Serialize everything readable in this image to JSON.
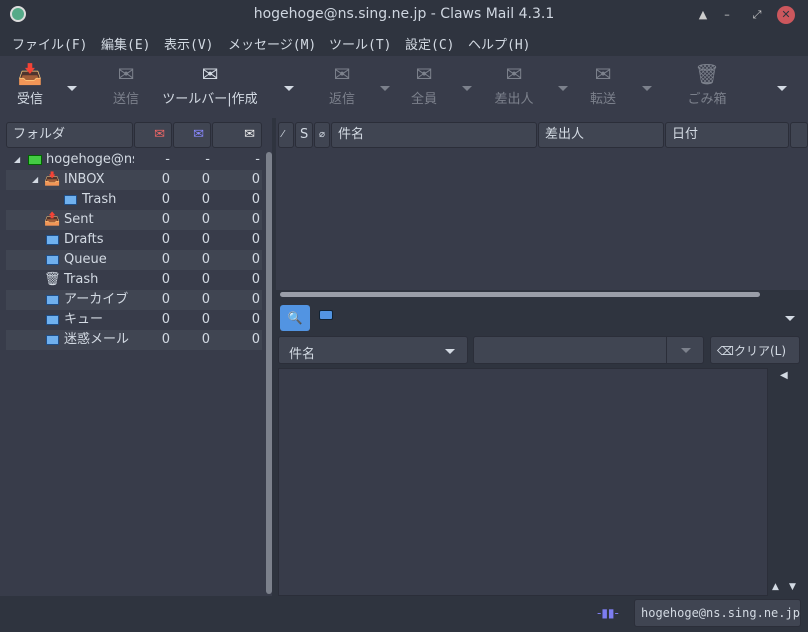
{
  "window": {
    "title": "hogehoge@ns.sing.ne.jp - Claws Mail 4.3.1"
  },
  "menu": [
    "ファイル(F)",
    "編集(E)",
    "表示(V)",
    "メッセージ(M)",
    "ツール(T)",
    "設定(C)",
    "ヘルプ(H)"
  ],
  "toolbar": {
    "receive": "受信",
    "send": "送信",
    "compose": "ツールバー|作成",
    "reply": "返信",
    "reply_all": "全員",
    "reply_sender": "差出人",
    "forward": "転送",
    "trash": "ごみ箱"
  },
  "folder_header": {
    "label": "フォルダ"
  },
  "folders": [
    {
      "name": "hogehoge@ns",
      "n": "-",
      "u": "-",
      "t": "-"
    },
    {
      "name": "INBOX",
      "n": "0",
      "u": "0",
      "t": "0"
    },
    {
      "name": "Trash",
      "n": "0",
      "u": "0",
      "t": "0"
    },
    {
      "name": "Sent",
      "n": "0",
      "u": "0",
      "t": "0"
    },
    {
      "name": "Drafts",
      "n": "0",
      "u": "0",
      "t": "0"
    },
    {
      "name": "Queue",
      "n": "0",
      "u": "0",
      "t": "0"
    },
    {
      "name": "Trash",
      "n": "0",
      "u": "0",
      "t": "0"
    },
    {
      "name": "アーカイブ",
      "n": "0",
      "u": "0",
      "t": "0"
    },
    {
      "name": "キュー",
      "n": "0",
      "u": "0",
      "t": "0"
    },
    {
      "name": "迷惑メール",
      "n": "0",
      "u": "0",
      "t": "0"
    }
  ],
  "message_columns": {
    "status": "S",
    "subject": "件名",
    "from": "差出人",
    "date": "日付"
  },
  "search": {
    "field": "件名",
    "value": "",
    "clear": "クリア(L)"
  },
  "status": {
    "account": "hogehoge@ns.sing.ne.jp"
  }
}
